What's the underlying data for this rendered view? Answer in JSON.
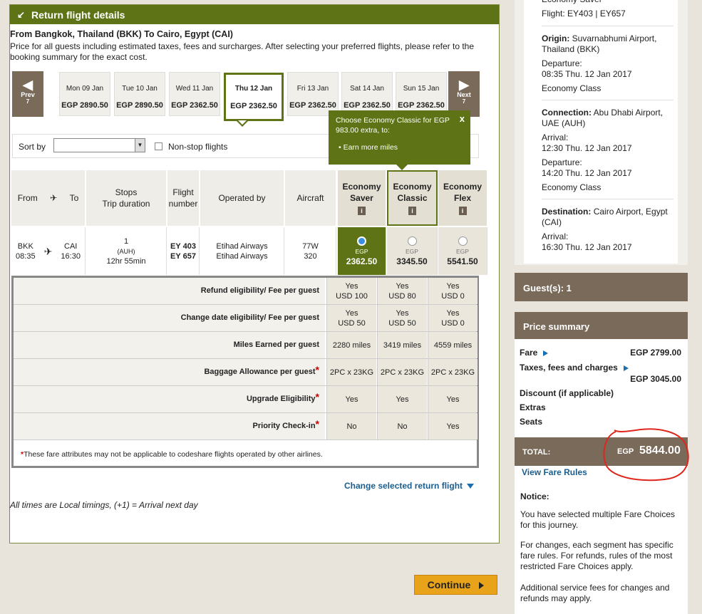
{
  "header": {
    "title": "Return flight details"
  },
  "route": {
    "title": "From Bangkok, Thailand (BKK) To Cairo, Egypt (CAI)",
    "description": "Price for all guests including estimated taxes, fees and surcharges. After selecting your preferred flights, please refer to the booking summary for the exact cost."
  },
  "date_nav": {
    "prev_label": "Prev",
    "prev_sub": "7",
    "next_label": "Next",
    "next_sub": "7",
    "dates": [
      {
        "day": "Mon 09 Jan",
        "price": "EGP 2890.50"
      },
      {
        "day": "Tue 10 Jan",
        "price": "EGP 2890.50"
      },
      {
        "day": "Wed 11 Jan",
        "price": "EGP 2362.50"
      },
      {
        "day": "Thu 12 Jan",
        "price": "EGP 2362.50"
      },
      {
        "day": "Fri 13 Jan",
        "price": "EGP 2362.50"
      },
      {
        "day": "Sat 14 Jan",
        "price": "EGP 2362.50"
      },
      {
        "day": "Sun 15 Jan",
        "price": "EGP 2362.50"
      }
    ]
  },
  "sort": {
    "label": "Sort by",
    "value": "",
    "nonstop_label": "Non-stop flights"
  },
  "tooltip": {
    "text": "Choose Economy Classic for EGP 983.00 extra, to:",
    "bullet": "Earn more miles",
    "close": "x"
  },
  "table": {
    "headers": {
      "from": "From",
      "to": "To",
      "stops": "Stops",
      "trip_duration": "Trip duration",
      "flight_number": "Flight number",
      "operated_by": "Operated by",
      "aircraft": "Aircraft"
    },
    "fares": [
      {
        "name_1": "Economy",
        "name_2": "Saver",
        "currency": "EGP",
        "price": "2362.50"
      },
      {
        "name_1": "Economy",
        "name_2": "Classic",
        "currency": "EGP",
        "price": "3345.50"
      },
      {
        "name_1": "Economy",
        "name_2": "Flex",
        "currency": "EGP",
        "price": "5541.50"
      }
    ],
    "info_icon": "i",
    "row": {
      "from_code": "BKK",
      "from_time": "08:35",
      "to_code": "CAI",
      "to_time": "16:30",
      "stops": "1",
      "via": "(AUH)",
      "duration": "12hr 55min",
      "flight_1": "EY 403",
      "flight_2": "EY 657",
      "operator_1": "Etihad Airways",
      "operator_2": "Etihad Airways",
      "aircraft_1": "77W",
      "aircraft_2": "320"
    }
  },
  "attributes": [
    {
      "label": "Refund eligibility/ Fee per guest",
      "req": false,
      "values": [
        [
          "Yes",
          "USD 100"
        ],
        [
          "Yes",
          "USD 80"
        ],
        [
          "Yes",
          "USD 0"
        ]
      ]
    },
    {
      "label": "Change date eligibility/ Fee per guest",
      "req": false,
      "values": [
        [
          "Yes",
          "USD 50"
        ],
        [
          "Yes",
          "USD 50"
        ],
        [
          "Yes",
          "USD 0"
        ]
      ]
    },
    {
      "label": "Miles Earned per guest",
      "req": false,
      "values": [
        [
          "2280 miles"
        ],
        [
          "3419 miles"
        ],
        [
          "4559 miles"
        ]
      ]
    },
    {
      "label": "Baggage Allowance per guest",
      "req": true,
      "values": [
        [
          "2PC x 23KG"
        ],
        [
          "2PC x 23KG"
        ],
        [
          "2PC x 23KG"
        ]
      ]
    },
    {
      "label": "Upgrade Eligibility",
      "req": true,
      "values": [
        [
          "Yes"
        ],
        [
          "Yes"
        ],
        [
          "Yes"
        ]
      ]
    },
    {
      "label": "Priority Check-in",
      "req": true,
      "values": [
        [
          "No"
        ],
        [
          "No"
        ],
        [
          "Yes"
        ]
      ]
    }
  ],
  "attr_note": {
    "star": "*",
    "text": "These fare attributes may not be applicable to codeshare flights operated by other airlines."
  },
  "change_link": "Change selected return flight",
  "times_note": "All times are Local timings, (+1) = Arrival next day",
  "continue_label": "Continue",
  "itinerary": {
    "top_class": "Economy Saver",
    "flight": "Flight: EY403 | EY657",
    "origin_label": "Origin:",
    "origin": "Suvarnabhumi Airport,",
    "origin_2": "Thailand (BKK)",
    "departure_label": "Departure:",
    "departure": "08:35 Thu. 12 Jan 2017",
    "class_1": "Economy Class",
    "connection_label": "Connection:",
    "connection": "Abu Dhabi Airport,",
    "connection_2": "UAE (AUH)",
    "arrival_label": "Arrival:",
    "arrival_1": "12:30 Thu. 12 Jan 2017",
    "departure_2_label": "Departure:",
    "departure_2": "14:20 Thu. 12 Jan 2017",
    "class_2": "Economy Class",
    "destination_label": "Destination:",
    "destination": "Cairo Airport, Egypt",
    "destination_2": "(CAI)",
    "arrival_2_label": "Arrival:",
    "arrival_2": "16:30 Thu. 12 Jan 2017"
  },
  "guests": "Guest(s): 1",
  "price_summary": {
    "title": "Price summary",
    "fare_label": "Fare",
    "fare_value": "EGP 2799.00",
    "taxes_label": "Taxes, fees and charges",
    "taxes_value": "EGP 3045.00",
    "discount_label": "Discount (if applicable)",
    "extras_label": "Extras",
    "seats_label": "Seats",
    "total_label": "TOTAL:",
    "total_currency": "EGP",
    "total_amount": "5844.00",
    "fare_rules": "View Fare Rules",
    "notice_title": "Notice:",
    "notice_1": "You have selected multiple Fare Choices for this journey.",
    "notice_2": "For changes, each segment has specific fare rules. For refunds, rules of the most restricted Fare Choices apply.",
    "notice_3": "Additional service fees for changes and refunds may apply."
  },
  "colors": {
    "accent_green": "#5d7316",
    "brown": "#7a6a5a",
    "link_blue": "#1a5d8f",
    "continue_orange": "#e8a31a",
    "annotation_red": "#e0261a"
  }
}
